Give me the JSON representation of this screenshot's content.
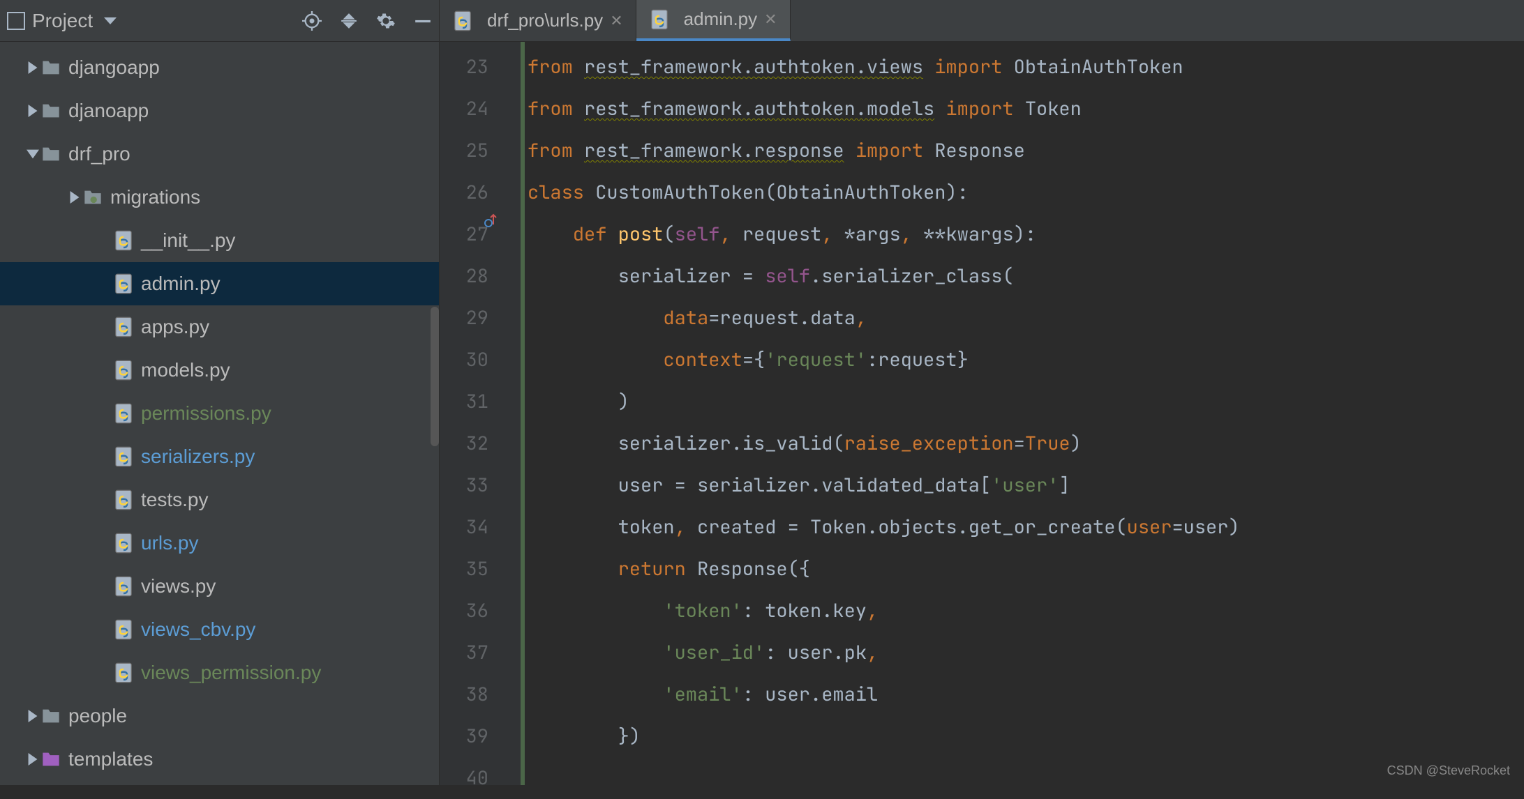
{
  "sidebar": {
    "title": "Project",
    "tree": [
      {
        "label": "djangoapp",
        "depth": 0,
        "kind": "folder",
        "caret": "right"
      },
      {
        "label": "djanoapp",
        "depth": 0,
        "kind": "folder",
        "caret": "right"
      },
      {
        "label": "drf_pro",
        "depth": 0,
        "kind": "folder",
        "caret": "down"
      },
      {
        "label": "migrations",
        "depth": 1,
        "kind": "pkg",
        "caret": "right"
      },
      {
        "label": "__init__.py",
        "depth": 1,
        "kind": "py",
        "caret": "none"
      },
      {
        "label": "admin.py",
        "depth": 1,
        "kind": "py",
        "caret": "none",
        "selected": true
      },
      {
        "label": "apps.py",
        "depth": 1,
        "kind": "py",
        "caret": "none"
      },
      {
        "label": "models.py",
        "depth": 1,
        "kind": "py",
        "caret": "none"
      },
      {
        "label": "permissions.py",
        "depth": 1,
        "kind": "py",
        "caret": "none",
        "color": "green"
      },
      {
        "label": "serializers.py",
        "depth": 1,
        "kind": "py",
        "caret": "none",
        "color": "blue"
      },
      {
        "label": "tests.py",
        "depth": 1,
        "kind": "py",
        "caret": "none"
      },
      {
        "label": "urls.py",
        "depth": 1,
        "kind": "py",
        "caret": "none",
        "color": "blue"
      },
      {
        "label": "views.py",
        "depth": 1,
        "kind": "py",
        "caret": "none"
      },
      {
        "label": "views_cbv.py",
        "depth": 1,
        "kind": "py",
        "caret": "none",
        "color": "blue"
      },
      {
        "label": "views_permission.py",
        "depth": 1,
        "kind": "py",
        "caret": "none",
        "color": "green"
      },
      {
        "label": "people",
        "depth": 0,
        "kind": "folder",
        "caret": "right"
      },
      {
        "label": "templates",
        "depth": 0,
        "kind": "tpl",
        "caret": "right"
      }
    ]
  },
  "tabs": [
    {
      "label": "drf_pro\\urls.py",
      "active": false
    },
    {
      "label": "admin.py",
      "active": true
    }
  ],
  "gutter_start": 23,
  "gutter_count": 18,
  "code_html": "<span class='kw'>from</span> <span class='squiggle'>rest_framework.authtoken.views</span> <span class='kw'>import</span> ObtainAuthToken\n<span class='kw'>from</span> <span class='squiggle'>rest_framework.authtoken.models</span> <span class='kw'>import</span> Token\n<span class='kw'>from</span> <span class='squiggle'>rest_framework.response</span> <span class='kw'>import</span> Response\n<span class='kw'>class</span> <span class='cls'>CustomAuthToken</span>(ObtainAuthToken):\n    <span class='kw'>def</span> <span class='fn'>post</span>(<span class='self'>self</span><span class='kw'>,</span> request<span class='kw'>,</span> *args<span class='kw'>,</span> **kwargs):\n        serializer = <span class='self'>self</span>.serializer_class(\n            <span class='param'>data</span>=request.data<span class='kw'>,</span>\n            <span class='param'>context</span>={<span class='str'>'request'</span>:request}\n        )\n        serializer.is_valid(<span class='param'>raise_exception</span>=<span class='kw'>True</span>)\n        user = serializer.validated_data[<span class='str'>'user'</span>]\n        token<span class='kw'>,</span> created = Token.objects.get_or_create(<span class='param'>user</span>=user)\n        <span class='kw'>return</span> Response({\n            <span class='str'>'token'</span>: token.key<span class='kw'>,</span>\n            <span class='str'>'user_id'</span>: user.pk<span class='kw'>,</span>\n            <span class='str'>'email'</span>: user.email\n        })\n",
  "watermark": "CSDN @SteveRocket"
}
